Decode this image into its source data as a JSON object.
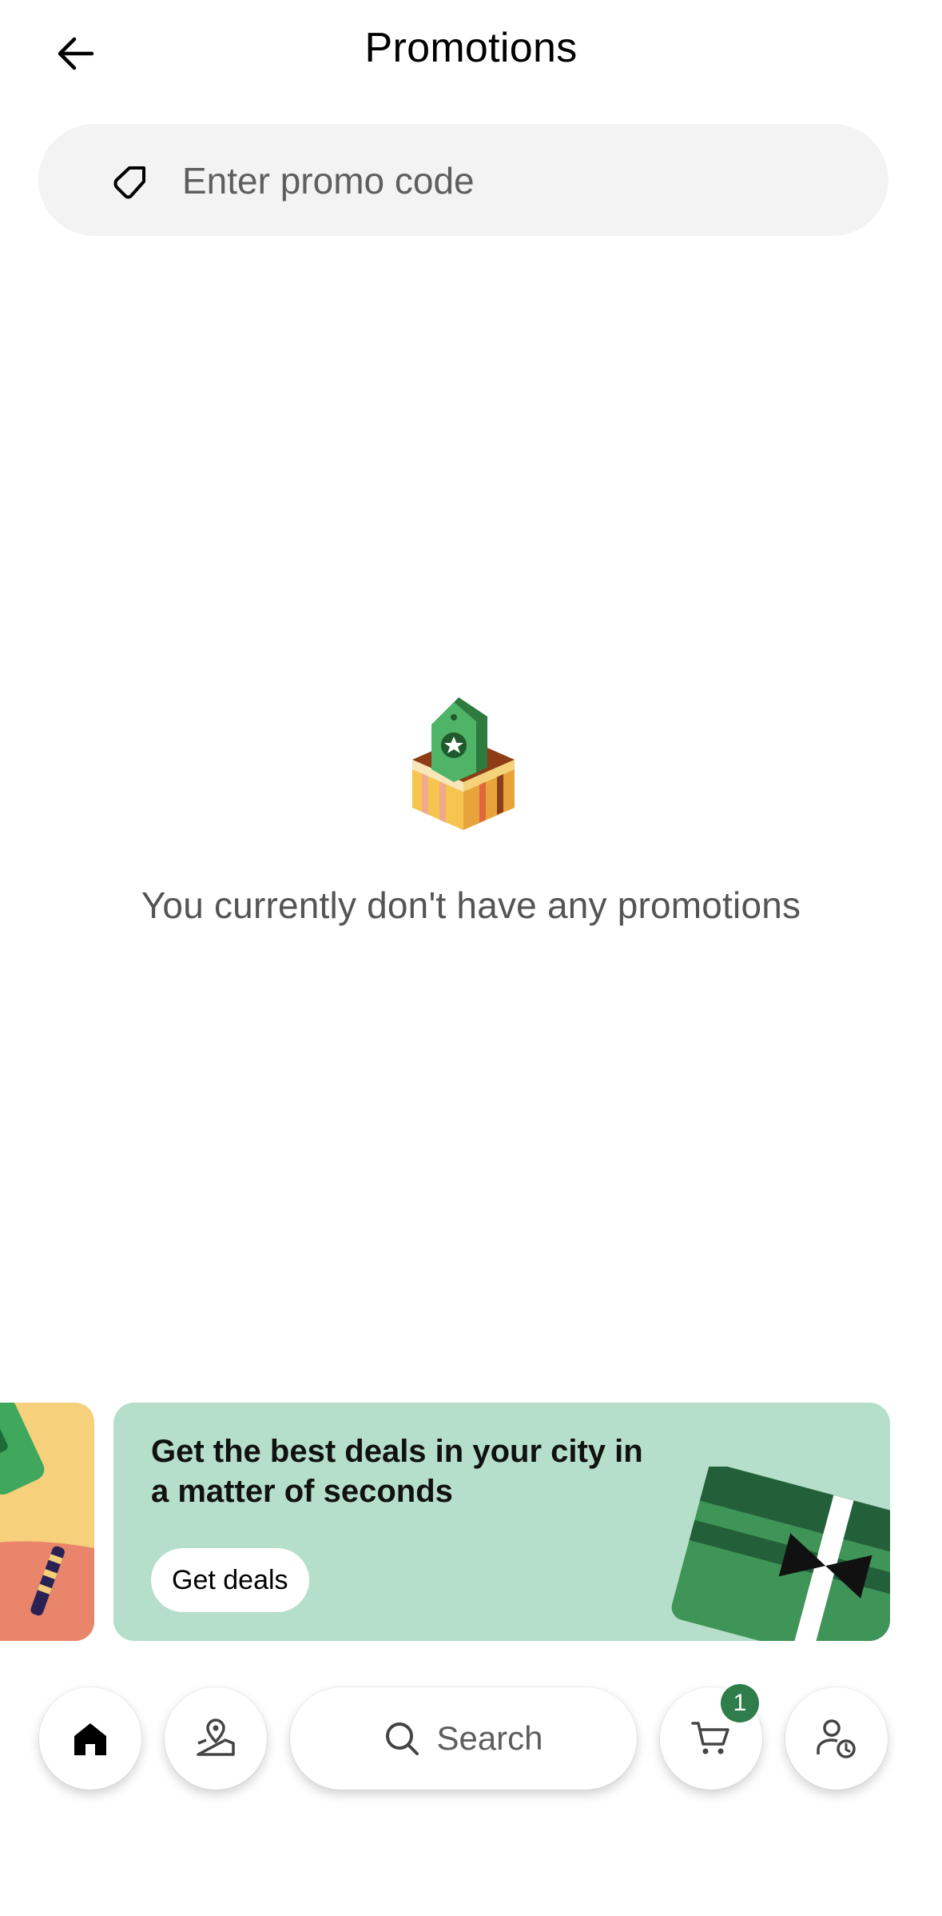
{
  "header": {
    "title": "Promotions",
    "back_icon": "arrow-left-icon"
  },
  "promo": {
    "placeholder": "Enter promo code",
    "icon": "tag-icon"
  },
  "empty_state": {
    "message": "You currently don't have any promotions",
    "illustration": "gift-box-with-tag-illustration"
  },
  "banner": {
    "headline": "Get the best deals in your city in a matter of seconds",
    "cta_label": "Get deals"
  },
  "nav": {
    "search_label": "Search",
    "cart_count": "1",
    "items": [
      "home-icon",
      "pickup-location-icon",
      "search-icon",
      "cart-icon",
      "account-icon"
    ]
  },
  "colors": {
    "input_bg": "#f3f3f3",
    "banner_bg": "#b5dfca",
    "prev_card_bg": "#f7d07c",
    "badge": "#2e7d4a"
  }
}
